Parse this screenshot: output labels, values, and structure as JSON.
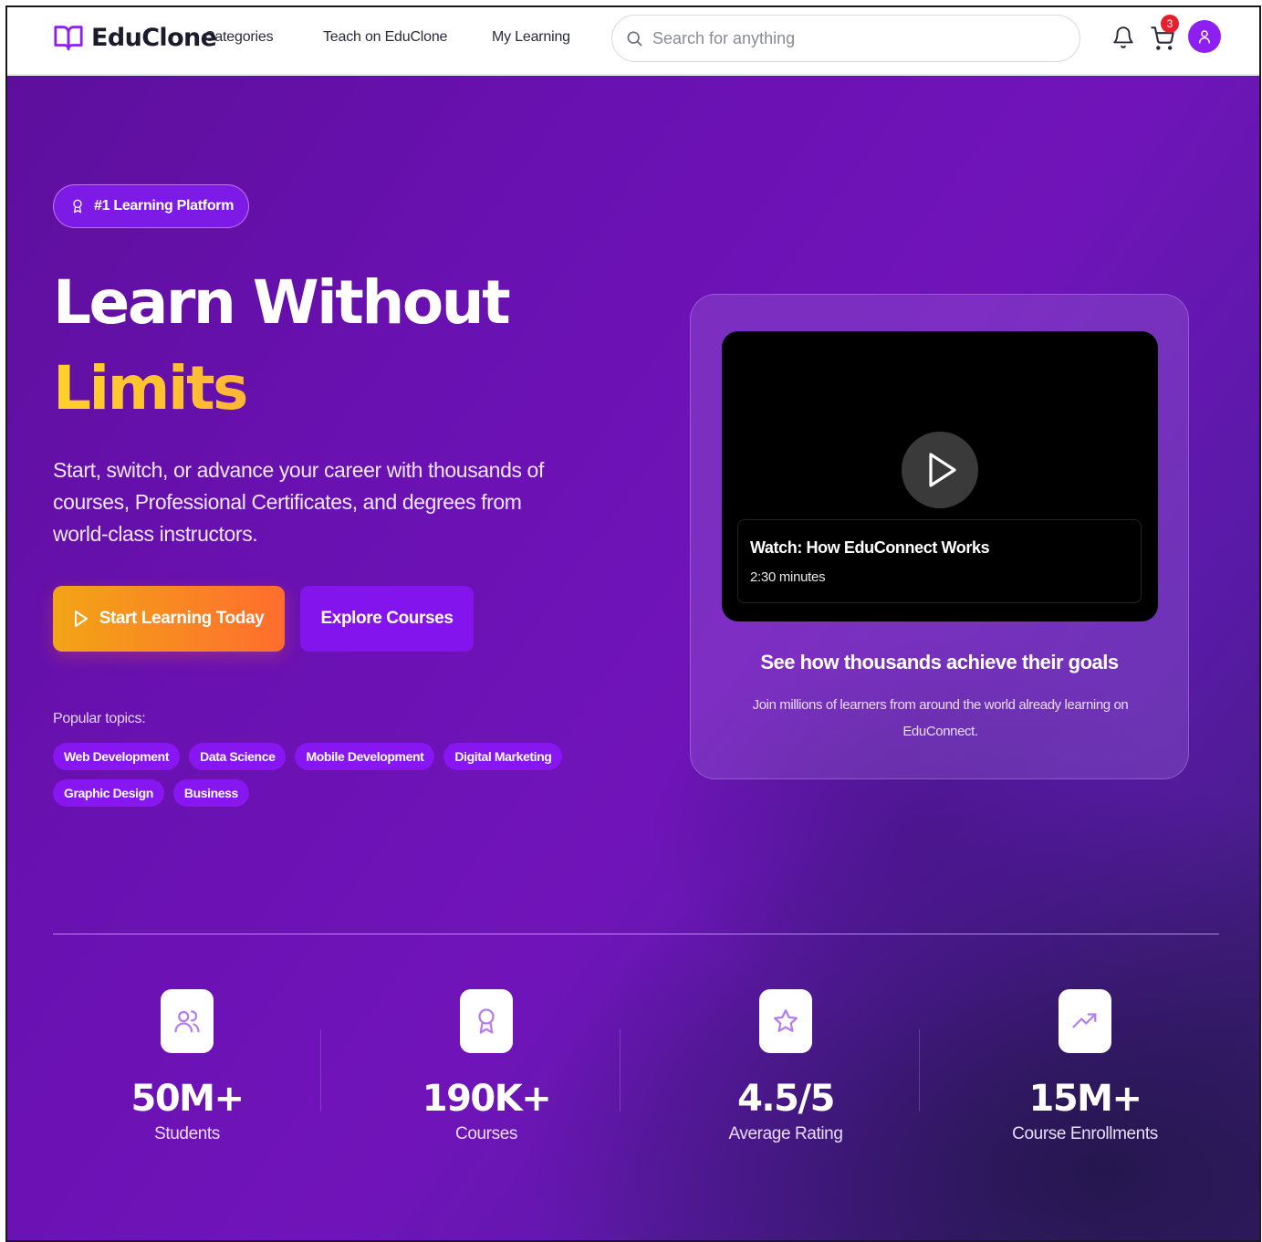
{
  "brand": {
    "name": "EduClone"
  },
  "nav": {
    "links": [
      "Categories",
      "Teach on EduClone",
      "My Learning"
    ]
  },
  "search": {
    "placeholder": "Search for anything"
  },
  "cart": {
    "count": "3"
  },
  "hero": {
    "badge": "#1 Learning Platform",
    "title_line1": "Learn Without",
    "title_line2": "Limits",
    "lead": "Start, switch, or advance your career with thousands of courses, Professional Certificates, and degrees from world-class instructors.",
    "primary_cta": "Start Learning Today",
    "secondary_cta": "Explore Courses",
    "popular_label": "Popular topics:",
    "topics": [
      "Web Development",
      "Data Science",
      "Mobile Development",
      "Digital Marketing",
      "Graphic Design",
      "Business"
    ]
  },
  "video_card": {
    "video_title": "Watch: How EduConnect Works",
    "video_duration": "2:30 minutes",
    "heading": "See how thousands achieve their goals",
    "text": "Join millions of learners from around the world already learning on EduConnect."
  },
  "stats": [
    {
      "icon": "users-icon",
      "value": "50M+",
      "label": "Students"
    },
    {
      "icon": "award-icon",
      "value": "190K+",
      "label": "Courses"
    },
    {
      "icon": "star-icon",
      "value": "4.5/5",
      "label": "Average Rating"
    },
    {
      "icon": "trending-up-icon",
      "value": "15M+",
      "label": "Course Enrollments"
    }
  ],
  "colors": {
    "accent": "#8e1ff0",
    "hero_gradient_start": "#5d0f9c",
    "cta_gradient_start": "#f2a516",
    "cta_gradient_end": "#ff6d2e",
    "highlight": "#ffd12a",
    "badge_red": "#e5202e"
  }
}
